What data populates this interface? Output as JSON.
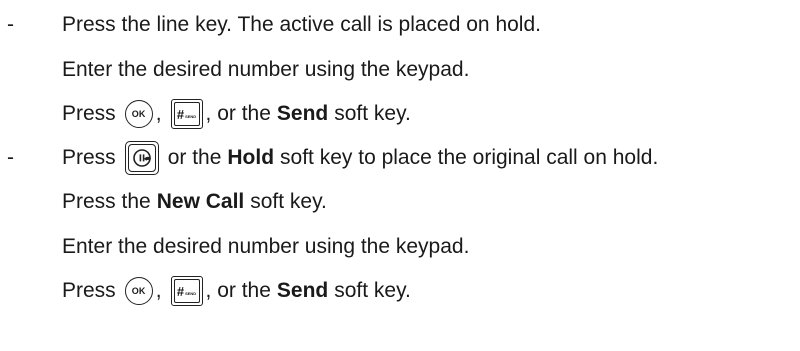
{
  "bullet": "-",
  "line1": "Press the line key. The active call is placed on hold.",
  "line2": "Enter the desired number using the keypad.",
  "press_word": "Press",
  "comma": ",",
  "ok_key_label": "OK",
  "send_key_hash": "#",
  "send_key_label": "SEND",
  "or_the": ", or the",
  "send_bold": "Send",
  "soft_key_end": "soft key.",
  "hold_prefix": "Press",
  "hold_or_the": "or the",
  "hold_bold": "Hold",
  "hold_suffix": "soft key to place the original call on hold.",
  "newcall_prefix": "Press the",
  "newcall_bold": "New Call",
  "newcall_suffix": "soft key.",
  "line6": "Enter the desired number using the keypad."
}
